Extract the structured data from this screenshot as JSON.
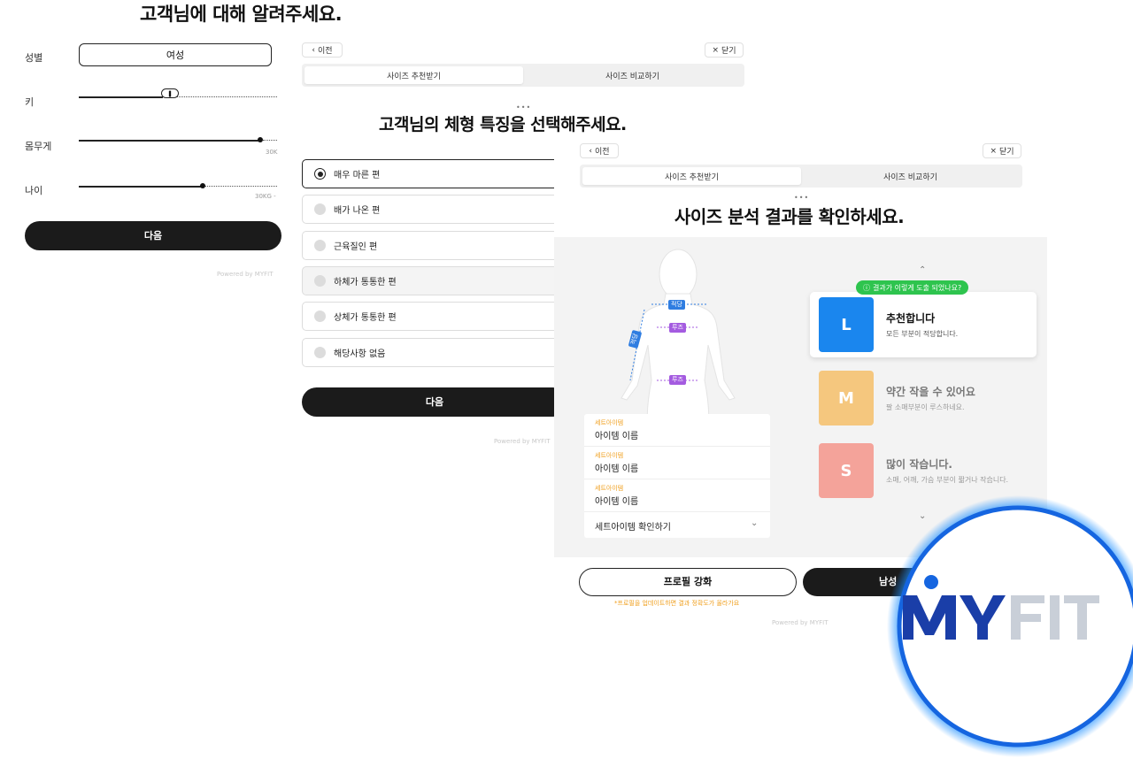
{
  "panel1": {
    "title": "고객님에 대해 알려주세요.",
    "labels": {
      "gender": "성별",
      "height": "키",
      "weight": "몸무게",
      "age": "나이"
    },
    "gender_value": "여성",
    "weight_tick": "30K",
    "age_tick": "30KG -",
    "next_label": "다음",
    "powered": "Powered by MYFIT"
  },
  "panel2": {
    "back_label": "이전",
    "close_label": "닫기",
    "tabs": [
      "사이즈 추천받기",
      "사이즈 비교하기"
    ],
    "dots": "•••",
    "title": "고객님의 체형 특징을 선택해주세요.",
    "options": [
      "매우 마른 편",
      "배가 나온 편",
      "근육질인 편",
      "하체가 통통한 편",
      "상체가 통통한 편",
      "해당사항 없음"
    ],
    "selected_index": 0,
    "next_label": "다음",
    "powered": "Powered by MYFIT"
  },
  "panel3": {
    "back_label": "이전",
    "close_label": "닫기",
    "tabs": [
      "사이즈 추천받기",
      "사이즈 비교하기"
    ],
    "dots": "•••",
    "title": "사이즈 분석 결과를 확인하세요.",
    "body_tags": {
      "shoulder": "적당",
      "sleeve": "적당",
      "chest": "루즈",
      "waist": "루즈"
    },
    "set_items": [
      {
        "category": "세트아이템",
        "name": "아이템 이름"
      },
      {
        "category": "세트아이템",
        "name": "아이템 이름"
      },
      {
        "category": "세트아이템",
        "name": "아이템 이름"
      }
    ],
    "set_toggle": "세트아이템 확인하기",
    "why_label": "결과가 이렇게 도출 되었나요?",
    "sizes": [
      {
        "size": "L",
        "title": "추천합니다",
        "desc": "모든 부분이 적당합니다.",
        "color": "#1a86ee"
      },
      {
        "size": "M",
        "title": "약간 작을 수 있어요",
        "desc": "팔 소매부분이 루스하네요.",
        "color": "#f5c77e"
      },
      {
        "size": "S",
        "title": "많이 작습니다.",
        "desc": "소매, 어깨, 가슴 부분이 짧거나 작습니다.",
        "color": "#f4a39a"
      }
    ],
    "profile_button": "프로필 강화",
    "dark_button": "남성",
    "note": "*프로필을 업데이트하면 결과 정확도가 올라가요",
    "powered": "Powered by MYFIT"
  },
  "logo": {
    "text": "MYFIT",
    "brand_color": "#1a3ea8",
    "glow_color": "#1e90ff"
  }
}
